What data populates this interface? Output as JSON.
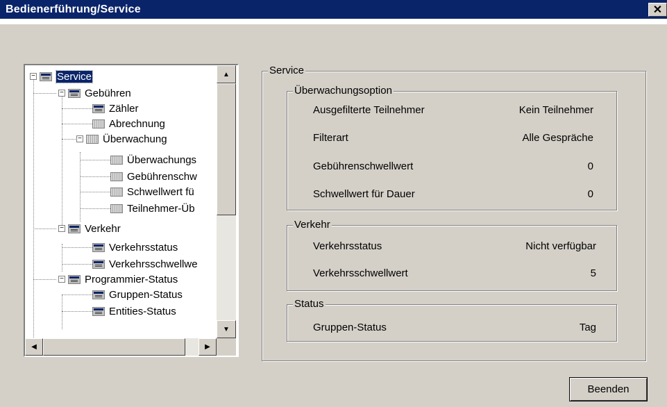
{
  "window": {
    "title": "Bedienerführung/Service",
    "close_label": "✕"
  },
  "tree": {
    "items": [
      {
        "label": "Service",
        "selected": true,
        "icon": "blue-folder-icon"
      },
      {
        "label": "Gebühren",
        "icon": "blue-folder-icon"
      },
      {
        "label": "Zähler",
        "icon": "blue-folder-icon"
      },
      {
        "label": "Abrechnung",
        "icon": "gray-folder-icon"
      },
      {
        "label": "Überwachung",
        "icon": "gray-folder-icon"
      },
      {
        "label": "Überwachungs",
        "icon": "gray-folder-icon"
      },
      {
        "label": "Gebührenschw",
        "icon": "gray-folder-icon"
      },
      {
        "label": "Schwellwert fü",
        "icon": "gray-folder-icon"
      },
      {
        "label": "Teilnehmer-Üb",
        "icon": "gray-folder-icon"
      },
      {
        "label": "Verkehr",
        "icon": "blue-folder-icon"
      },
      {
        "label": "Verkehrsstatus",
        "icon": "blue-folder-icon"
      },
      {
        "label": "Verkehrsschwellwe",
        "icon": "blue-folder-icon"
      },
      {
        "label": "Programmier-Status",
        "icon": "blue-folder-icon"
      },
      {
        "label": "Gruppen-Status",
        "icon": "blue-folder-icon"
      },
      {
        "label": "Entities-Status",
        "icon": "blue-folder-icon"
      }
    ]
  },
  "service_group": {
    "legend": "Service",
    "monitoring": {
      "legend": "Überwachungsoption",
      "rows": [
        {
          "label": "Ausgefilterte Teilnehmer",
          "value": "Kein Teilnehmer"
        },
        {
          "label": "Filterart",
          "value": "Alle Gespräche"
        },
        {
          "label": "Gebührenschwellwert",
          "value": "0"
        },
        {
          "label": "Schwellwert für Dauer",
          "value": "0"
        }
      ]
    },
    "traffic": {
      "legend": "Verkehr",
      "rows": [
        {
          "label": "Verkehrsstatus",
          "value": "Nicht verfügbar"
        },
        {
          "label": "Verkehrsschwellwert",
          "value": "5"
        }
      ]
    },
    "status": {
      "legend": "Status",
      "rows": [
        {
          "label": "Gruppen-Status",
          "value": "Tag"
        }
      ]
    }
  },
  "footer": {
    "exit_label": "Beenden"
  }
}
